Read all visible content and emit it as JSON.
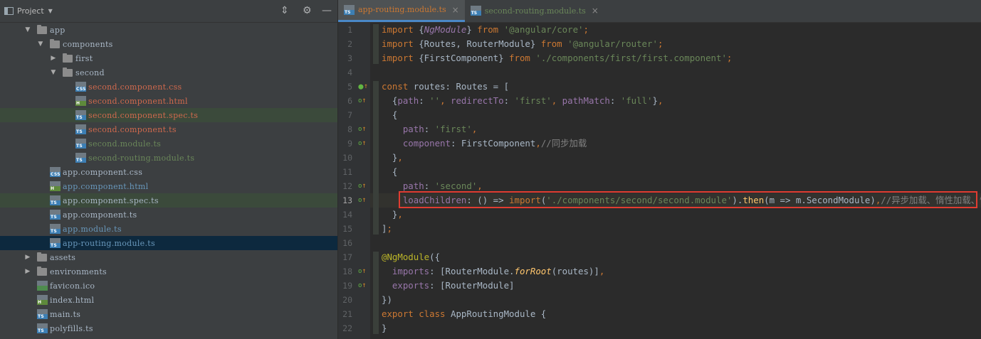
{
  "project_panel": {
    "title": "Project",
    "tree": [
      {
        "label": "app",
        "type": "folder",
        "expanded": true,
        "depth": 2,
        "color": "#a9b7c6"
      },
      {
        "label": "components",
        "type": "folder",
        "expanded": true,
        "depth": 3,
        "color": "#a9b7c6"
      },
      {
        "label": "first",
        "type": "folder",
        "expanded": false,
        "depth": 4,
        "color": "#a9b7c6"
      },
      {
        "label": "second",
        "type": "folder",
        "expanded": true,
        "depth": 4,
        "color": "#a9b7c6"
      },
      {
        "label": "second.component.css",
        "type": "css",
        "depth": 5,
        "color": "#d0694d"
      },
      {
        "label": "second.component.html",
        "type": "html",
        "depth": 5,
        "color": "#d0694d"
      },
      {
        "label": "second.component.spec.ts",
        "type": "ts",
        "depth": 5,
        "color": "#d0694d",
        "spec": true
      },
      {
        "label": "second.component.ts",
        "type": "ts",
        "depth": 5,
        "color": "#d0694d"
      },
      {
        "label": "second.module.ts",
        "type": "ts",
        "depth": 5,
        "color": "#6a8759"
      },
      {
        "label": "second-routing.module.ts",
        "type": "ts",
        "depth": 5,
        "color": "#6a8759"
      },
      {
        "label": "app.component.css",
        "type": "css",
        "depth": 3,
        "color": "#a9b7c6"
      },
      {
        "label": "app.component.html",
        "type": "html",
        "depth": 3,
        "color": "#6897bb"
      },
      {
        "label": "app.component.spec.ts",
        "type": "ts",
        "depth": 3,
        "color": "#a9b7c6",
        "spec": true
      },
      {
        "label": "app.component.ts",
        "type": "ts",
        "depth": 3,
        "color": "#a9b7c6"
      },
      {
        "label": "app.module.ts",
        "type": "ts",
        "depth": 3,
        "color": "#6897bb"
      },
      {
        "label": "app-routing.module.ts",
        "type": "ts",
        "depth": 3,
        "color": "#6897bb",
        "selected": true
      },
      {
        "label": "assets",
        "type": "folder",
        "expanded": false,
        "depth": 2,
        "color": "#a9b7c6"
      },
      {
        "label": "environments",
        "type": "folder",
        "expanded": false,
        "depth": 2,
        "color": "#a9b7c6"
      },
      {
        "label": "favicon.ico",
        "type": "ico",
        "depth": 2,
        "color": "#a9b7c6"
      },
      {
        "label": "index.html",
        "type": "html",
        "depth": 2,
        "color": "#a9b7c6"
      },
      {
        "label": "main.ts",
        "type": "ts",
        "depth": 2,
        "color": "#a9b7c6"
      },
      {
        "label": "polyfills.ts",
        "type": "ts",
        "depth": 2,
        "color": "#a9b7c6"
      }
    ]
  },
  "tabs": [
    {
      "label": "app-routing.module.ts",
      "active": true
    },
    {
      "label": "second-routing.module.ts",
      "active": false
    }
  ],
  "icons": {
    "close": "×",
    "collapse": "⇕",
    "settings": "⚙",
    "hide": "—",
    "caret": "▼",
    "ts_badge": "TS",
    "css_badge": "CSS",
    "html_badge": "H"
  },
  "editor": {
    "current_line": 13,
    "lines": [
      {
        "n": 1,
        "tokens": [
          [
            "kw",
            "import "
          ],
          [
            "cls",
            "{"
          ],
          [
            "ital",
            "NgModule"
          ],
          [
            "cls",
            "} "
          ],
          [
            "kw",
            "from "
          ],
          [
            "str",
            "'@angular/core'"
          ],
          [
            "kw",
            ";"
          ]
        ]
      },
      {
        "n": 2,
        "tokens": [
          [
            "kw",
            "import "
          ],
          [
            "cls",
            "{Routes, RouterModule} "
          ],
          [
            "kw",
            "from "
          ],
          [
            "str",
            "'@angular/router'"
          ],
          [
            "kw",
            ";"
          ]
        ]
      },
      {
        "n": 3,
        "tokens": [
          [
            "kw",
            "import "
          ],
          [
            "cls",
            "{FirstComponent} "
          ],
          [
            "kw",
            "from "
          ],
          [
            "str",
            "'./components/first/first.component'"
          ],
          [
            "kw",
            ";"
          ]
        ]
      },
      {
        "n": 4,
        "tokens": []
      },
      {
        "n": 5,
        "tokens": [
          [
            "kw",
            "const "
          ],
          [
            "cls",
            "routes: Routes = ["
          ]
        ],
        "mark": "⬤"
      },
      {
        "n": 6,
        "tokens": [
          [
            "cls",
            "  {"
          ],
          [
            "prop",
            "path"
          ],
          [
            "cls",
            ": "
          ],
          [
            "str",
            "''"
          ],
          [
            "kw",
            ", "
          ],
          [
            "prop",
            "redirectTo"
          ],
          [
            "cls",
            ": "
          ],
          [
            "str",
            "'first'"
          ],
          [
            "kw",
            ", "
          ],
          [
            "prop",
            "pathMatch"
          ],
          [
            "cls",
            ": "
          ],
          [
            "str",
            "'full'"
          ],
          [
            "cls",
            "}"
          ],
          [
            "kw",
            ","
          ]
        ],
        "mark": "o↑"
      },
      {
        "n": 7,
        "tokens": [
          [
            "cls",
            "  {"
          ]
        ]
      },
      {
        "n": 8,
        "tokens": [
          [
            "cls",
            "    "
          ],
          [
            "prop",
            "path"
          ],
          [
            "cls",
            ": "
          ],
          [
            "str",
            "'first'"
          ],
          [
            "kw",
            ","
          ]
        ],
        "mark": "o↑"
      },
      {
        "n": 9,
        "tokens": [
          [
            "cls",
            "    "
          ],
          [
            "prop",
            "component"
          ],
          [
            "cls",
            ": FirstComponent"
          ],
          [
            "kw",
            ","
          ],
          [
            "cmt",
            "//同步加载"
          ]
        ],
        "mark": "o↑"
      },
      {
        "n": 10,
        "tokens": [
          [
            "cls",
            "  }"
          ],
          [
            "kw",
            ","
          ]
        ]
      },
      {
        "n": 11,
        "tokens": [
          [
            "cls",
            "  {"
          ]
        ]
      },
      {
        "n": 12,
        "tokens": [
          [
            "cls",
            "    "
          ],
          [
            "prop",
            "path"
          ],
          [
            "cls",
            ": "
          ],
          [
            "str",
            "'second'"
          ],
          [
            "kw",
            ","
          ]
        ],
        "mark": "o↑"
      },
      {
        "n": 13,
        "tokens": [
          [
            "cls",
            "    "
          ],
          [
            "prop",
            "loadChildren"
          ],
          [
            "cls",
            ": () => "
          ],
          [
            "kw",
            "import"
          ],
          [
            "cls",
            "("
          ],
          [
            "str",
            "'./components/second/second.module'"
          ],
          [
            "cls",
            ")."
          ],
          [
            "fn2",
            "then"
          ],
          [
            "cls",
            "(m => m.SecondModule)"
          ],
          [
            "kw",
            ","
          ],
          [
            "cmt",
            "//异步加载、惰性加载、懒加载"
          ]
        ],
        "mark": "o↑"
      },
      {
        "n": 14,
        "tokens": [
          [
            "cls",
            "  }"
          ],
          [
            "kw",
            ","
          ]
        ]
      },
      {
        "n": 15,
        "tokens": [
          [
            "cls",
            "]"
          ],
          [
            "kw",
            ";"
          ]
        ]
      },
      {
        "n": 16,
        "tokens": []
      },
      {
        "n": 17,
        "tokens": [
          [
            "ann",
            "@NgModule"
          ],
          [
            "cls",
            "({"
          ]
        ]
      },
      {
        "n": 18,
        "tokens": [
          [
            "cls",
            "  "
          ],
          [
            "prop",
            "imports"
          ],
          [
            "cls",
            ": [RouterModule."
          ],
          [
            "fn",
            "forRoot"
          ],
          [
            "cls",
            "(routes)]"
          ],
          [
            "kw",
            ","
          ]
        ],
        "mark": "o↑"
      },
      {
        "n": 19,
        "tokens": [
          [
            "cls",
            "  "
          ],
          [
            "prop",
            "exports"
          ],
          [
            "cls",
            ": [RouterModule]"
          ]
        ],
        "mark": "o↑"
      },
      {
        "n": 20,
        "tokens": [
          [
            "cls",
            "})"
          ]
        ]
      },
      {
        "n": 21,
        "tokens": [
          [
            "kw",
            "export class "
          ],
          [
            "cls",
            "AppRoutingModule {"
          ]
        ]
      },
      {
        "n": 22,
        "tokens": [
          [
            "cls",
            "}"
          ]
        ]
      }
    ]
  }
}
